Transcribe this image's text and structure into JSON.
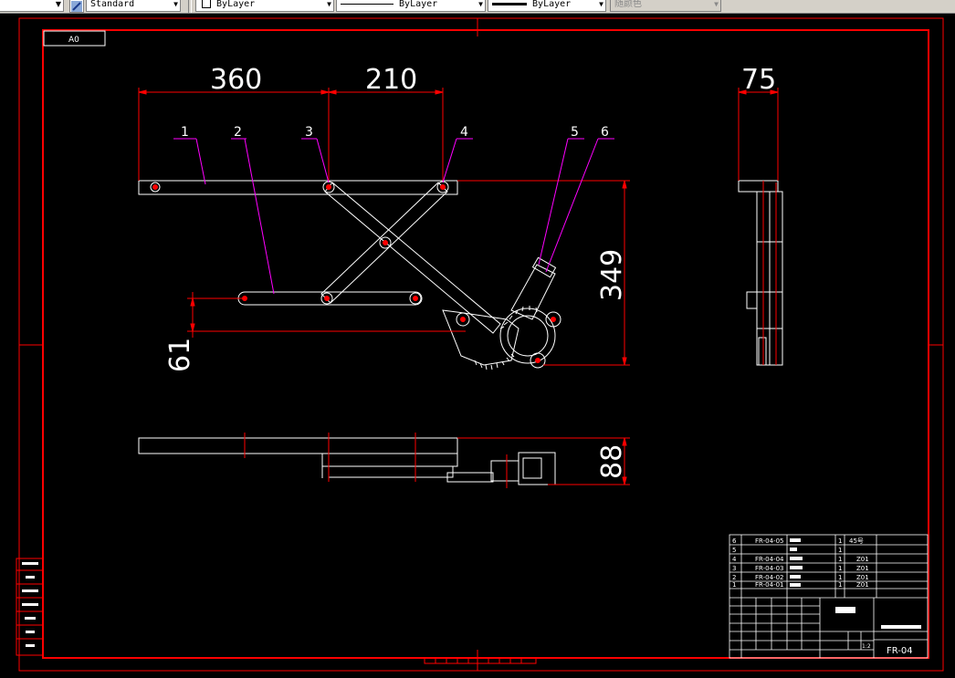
{
  "toolbar": {
    "textstyle_value": "Standard",
    "layer_value": "ByLayer",
    "linetype_value": "ByLayer",
    "lineweight_value": "ByLayer",
    "plotstyle_value": "随颜色"
  },
  "drawing": {
    "sheet_label": "A0",
    "dimensions": {
      "d360": "360",
      "d210": "210",
      "d75": "75",
      "d349": "349",
      "d61": "61",
      "d88": "88"
    },
    "balloons": [
      "1",
      "2",
      "3",
      "4",
      "5",
      "6"
    ],
    "title_block": {
      "part_rows": [
        {
          "no": "6",
          "code": "FR-04-05",
          "qty": "1",
          "material": "45号"
        },
        {
          "no": "5",
          "code": "",
          "qty": "1",
          "material": ""
        },
        {
          "no": "4",
          "code": "FR-04-04",
          "qty": "1",
          "material": "Z01"
        },
        {
          "no": "3",
          "code": "FR-04-03",
          "qty": "1",
          "material": "Z01"
        },
        {
          "no": "2",
          "code": "FR-04-02",
          "qty": "1",
          "material": "Z01"
        },
        {
          "no": "1",
          "code": "FR-04-01",
          "qty": "1",
          "material": "Z01"
        }
      ],
      "drawing_number": "FR-04",
      "scale_hint": "1:2"
    }
  },
  "colors": {
    "background": "#000000",
    "border": "#ff0000",
    "geometry": "#ffffff",
    "dimension": "#ff0000",
    "leader": "#ff00ff"
  }
}
